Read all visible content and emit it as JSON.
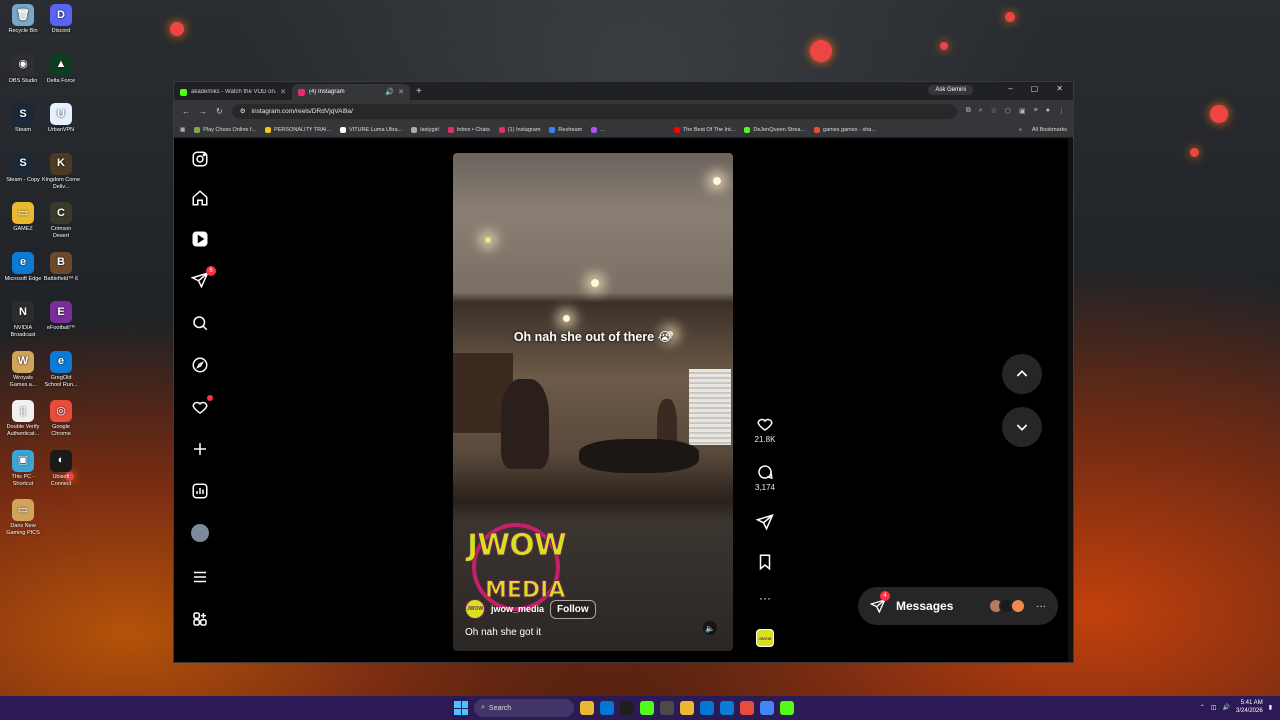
{
  "desktop": {
    "icons": [
      {
        "label": "Recycle Bin",
        "color": "#7aa7c7",
        "glyph": "🗑"
      },
      {
        "label": "Discord",
        "color": "#5865f2",
        "glyph": "D"
      },
      {
        "label": "OBS Studio",
        "color": "#302e31",
        "glyph": "◉"
      },
      {
        "label": "Delta Force",
        "color": "#0f3d1f",
        "glyph": "▲"
      },
      {
        "label": "Steam",
        "color": "#1b2838",
        "glyph": "S"
      },
      {
        "label": "UrbanVPN",
        "color": "#e6f0ff",
        "glyph": "U"
      },
      {
        "label": "Steam - Copy",
        "color": "#1b2838",
        "glyph": "S"
      },
      {
        "label": "Kingdom Come Deliv...",
        "color": "#4a3b22",
        "glyph": "K"
      },
      {
        "label": "GAMEZ",
        "color": "#e8b931",
        "glyph": "▭"
      },
      {
        "label": "Crimson Desert",
        "color": "#3a3a2c",
        "glyph": "C"
      },
      {
        "label": "Microsoft Edge",
        "color": "#0c7bd6",
        "glyph": "e"
      },
      {
        "label": "Battlefield™ 6",
        "color": "#6b4a2c",
        "glyph": "B"
      },
      {
        "label": "NVIDIA Broadcast",
        "color": "#2c2c2c",
        "glyph": "N"
      },
      {
        "label": "eFootball™",
        "color": "#7c2d9c",
        "glyph": "E"
      },
      {
        "label": "Wroyals Games a...",
        "color": "#d1a45c",
        "glyph": "W"
      },
      {
        "label": "GregOld School Run...",
        "color": "#0c7bd6",
        "glyph": "e"
      },
      {
        "label": "Double Verify Authenticat...",
        "color": "#f0f0f0",
        "glyph": "▯"
      },
      {
        "label": "Google Chrome",
        "color": "#e84c3d",
        "glyph": "◎"
      },
      {
        "label": "This PC - Shortcut",
        "color": "#3aa6d8",
        "glyph": "▣"
      },
      {
        "label": "Ubisoft Connect",
        "color": "#1a1a1a",
        "glyph": "◐"
      },
      {
        "label": "Dans New Gaming PICS",
        "color": "#d1a45c",
        "glyph": "▭"
      }
    ]
  },
  "browser": {
    "tabs": [
      {
        "title": "akademiks - Watch the VOD on...",
        "favicon_color": "#53fc18",
        "active": false
      },
      {
        "title": "(4) Instagram",
        "favicon_color": "#e1306c",
        "active": true
      }
    ],
    "new_tab_icon": "+",
    "ask_gemini": "Ask Gemini",
    "window_controls": [
      "–",
      "▢",
      "✕"
    ],
    "url": "instagram.com/reels/DRdVjqVAl9a/",
    "bookmarks": [
      {
        "label": "Play Chess Online f...",
        "color": "#7fa650"
      },
      {
        "label": "PERSONALITY TRAI...",
        "color": "#f5c518"
      },
      {
        "label": "VITURE Luma Ultra...",
        "color": "#ffffff"
      },
      {
        "label": "lastygirl",
        "color": "#aaaaaa"
      },
      {
        "label": "Inbox • Chats",
        "color": "#e1306c"
      },
      {
        "label": "(1) Instagram",
        "color": "#e1306c"
      },
      {
        "label": "Restream",
        "color": "#3b82f6"
      },
      {
        "label": "...",
        "color": "#a855f7"
      },
      {
        "label": "The Best Of The Int...",
        "color": "#ff0000"
      },
      {
        "label": "DeJenQueen Strea...",
        "color": "#53fc18"
      },
      {
        "label": "games games - sha...",
        "color": "#e84c3d"
      }
    ],
    "all_bookmarks": "All Bookmarks"
  },
  "instagram": {
    "sidebar": [
      {
        "name": "instagram-logo-icon",
        "icon": "instagram"
      },
      {
        "name": "home-icon",
        "icon": "home"
      },
      {
        "name": "reels-icon",
        "icon": "reels"
      },
      {
        "name": "direct-messages-icon",
        "icon": "send",
        "badge": "6"
      },
      {
        "name": "search-icon",
        "icon": "search"
      },
      {
        "name": "explore-icon",
        "icon": "explore"
      },
      {
        "name": "notifications-icon",
        "icon": "heart",
        "dot": true
      },
      {
        "name": "create-icon",
        "icon": "plus"
      },
      {
        "name": "dashboard-icon",
        "icon": "chart"
      },
      {
        "name": "profile-avatar",
        "icon": "avatar"
      },
      {
        "name": "more-menu-icon",
        "icon": "menu"
      },
      {
        "name": "also-from-meta-icon",
        "icon": "grid"
      }
    ],
    "reel": {
      "caption_overlay": "Oh nah she out of there 😭",
      "overlay_logo_top": "JWOW",
      "overlay_logo_bottom": "MEDIA",
      "author": "jwow_media",
      "follow_label": "Follow",
      "caption": "Oh nah she got it",
      "avatar_text": "JWOW"
    },
    "actions": {
      "likes": "21.8K",
      "comments": "3,174",
      "more": "···"
    },
    "messages": {
      "label": "Messages",
      "badge": "4",
      "more": "···",
      "avatar_colors": [
        "#b47b5c",
        "#1a1a1a",
        "#f08a4b"
      ]
    }
  },
  "taskbar": {
    "search_placeholder": "Search",
    "time": "5:41 AM",
    "date": "3/24/2026",
    "pinned_colors": [
      "#e8b931",
      "#0078d4",
      "#1f1f1f",
      "#53fc18",
      "#4a4a4a",
      "#e8b931",
      "#0078d4",
      "#0c7bd6",
      "#e84c3d",
      "#4285f4",
      "#53fc18"
    ]
  }
}
